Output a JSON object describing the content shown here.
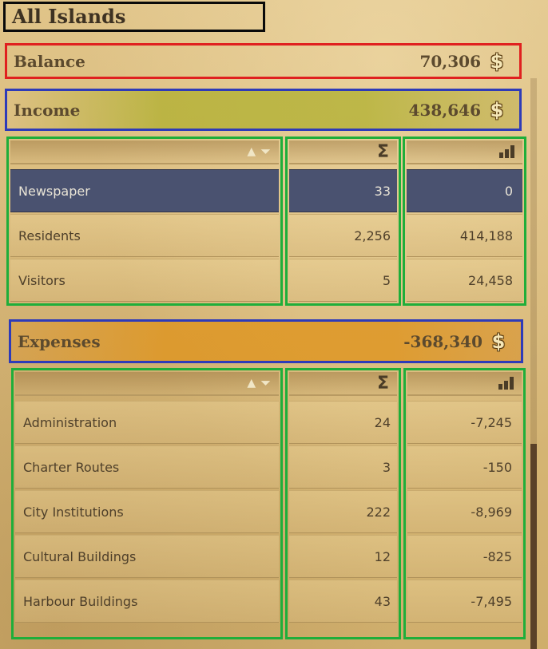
{
  "title": "All Islands",
  "balance": {
    "label": "Balance",
    "value": "70,306",
    "icon": "coin-icon"
  },
  "income": {
    "label": "Income",
    "value": "438,646",
    "icon": "coin-icon",
    "headers": {
      "sort_icon": "sort-up-icon",
      "filter_icon": "filter-icon",
      "count_symbol": "Σ",
      "chart_icon": "bar-chart-icon"
    },
    "rows": [
      {
        "name": "Newspaper",
        "count": "33",
        "amount": "0",
        "selected": true
      },
      {
        "name": "Residents",
        "count": "2,256",
        "amount": "414,188"
      },
      {
        "name": "Visitors",
        "count": "5",
        "amount": "24,458"
      }
    ]
  },
  "expenses": {
    "label": "Expenses",
    "value": "-368,340",
    "icon": "coin-icon",
    "headers": {
      "sort_icon": "sort-up-icon",
      "filter_icon": "filter-icon",
      "count_symbol": "Σ",
      "chart_icon": "bar-chart-icon"
    },
    "rows": [
      {
        "name": "Administration",
        "count": "24",
        "amount": "-7,245"
      },
      {
        "name": "Charter Routes",
        "count": "3",
        "amount": "-150"
      },
      {
        "name": "City Institutions",
        "count": "222",
        "amount": "-8,969"
      },
      {
        "name": "Cultural Buildings",
        "count": "12",
        "amount": "-825"
      },
      {
        "name": "Harbour Buildings",
        "count": "43",
        "amount": "-7,495"
      }
    ]
  },
  "colors": {
    "selected_row": "#4a5270",
    "income_bar": "#afaf2d",
    "expenses_bar": "#de9623"
  }
}
